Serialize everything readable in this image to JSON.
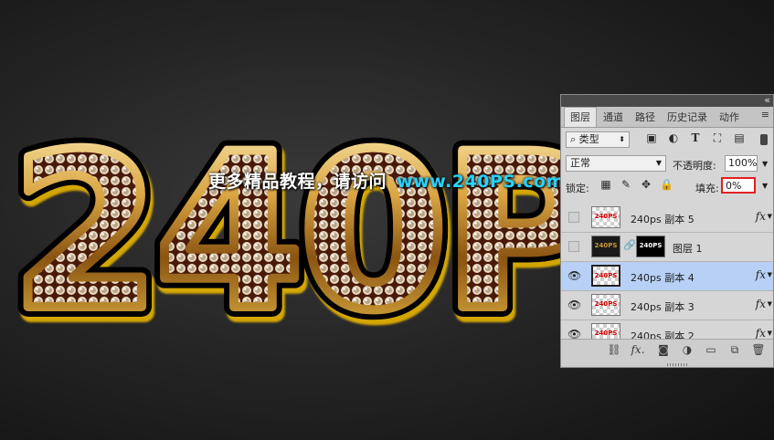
{
  "canvas": {
    "artwork_text": "240P",
    "watermark": {
      "chinese": "更多精品教程，请访问",
      "url": "www.240PS.com"
    },
    "colors": {
      "background": "#262626",
      "gold": "#d9a441",
      "watermark_url": "#27d3ff"
    }
  },
  "layers_panel": {
    "tabs": [
      {
        "label": "图层",
        "active": true
      },
      {
        "label": "通道",
        "active": false
      },
      {
        "label": "路径",
        "active": false
      },
      {
        "label": "历史记录",
        "active": false
      },
      {
        "label": "动作",
        "active": false
      }
    ],
    "filter": {
      "label": "类型",
      "icons": [
        "image-filter-icon",
        "adjustment-filter-icon",
        "type-filter-icon",
        "shape-filter-icon",
        "smart-object-filter-icon"
      ]
    },
    "blend_mode": "正常",
    "opacity": {
      "label": "不透明度:",
      "value": "100%"
    },
    "lock": {
      "label": "锁定:"
    },
    "fill": {
      "label": "填充:",
      "value": "0%"
    },
    "layers": [
      {
        "name": "240ps 副本 5",
        "visible": false,
        "selected": false,
        "fx": "fx",
        "thumb_text": "240PS"
      },
      {
        "name": "图层 1",
        "visible": false,
        "selected": false,
        "fx": "",
        "thumb_text": "240PS",
        "mask_text": "240PS"
      },
      {
        "name": "240ps 副本 4",
        "visible": true,
        "selected": true,
        "fx": "fx",
        "thumb_text": "240PS"
      },
      {
        "name": "240ps 副本 3",
        "visible": true,
        "selected": false,
        "fx": "fx",
        "thumb_text": "240PS"
      },
      {
        "name": "240ps 副本 2",
        "visible": true,
        "selected": false,
        "fx": "fx",
        "thumb_text": "240PS"
      }
    ],
    "bottom_fx": "fx."
  }
}
